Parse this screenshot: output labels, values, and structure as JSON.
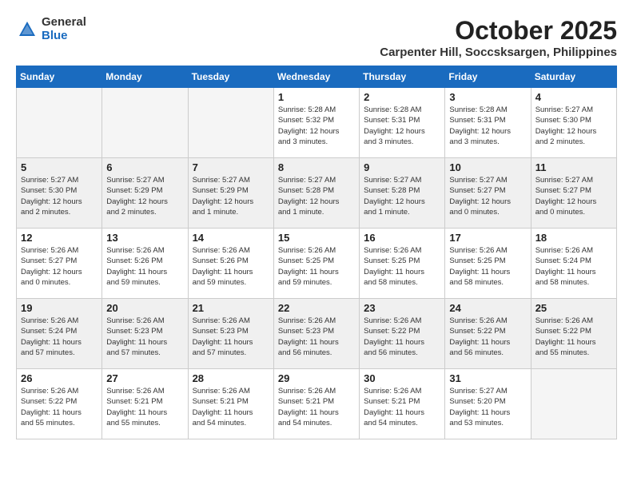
{
  "logo": {
    "general": "General",
    "blue": "Blue"
  },
  "header": {
    "month": "October 2025",
    "location": "Carpenter Hill, Soccsksargen, Philippines"
  },
  "weekdays": [
    "Sunday",
    "Monday",
    "Tuesday",
    "Wednesday",
    "Thursday",
    "Friday",
    "Saturday"
  ],
  "weeks": [
    [
      {
        "day": "",
        "info": ""
      },
      {
        "day": "",
        "info": ""
      },
      {
        "day": "",
        "info": ""
      },
      {
        "day": "1",
        "info": "Sunrise: 5:28 AM\nSunset: 5:32 PM\nDaylight: 12 hours\nand 3 minutes."
      },
      {
        "day": "2",
        "info": "Sunrise: 5:28 AM\nSunset: 5:31 PM\nDaylight: 12 hours\nand 3 minutes."
      },
      {
        "day": "3",
        "info": "Sunrise: 5:28 AM\nSunset: 5:31 PM\nDaylight: 12 hours\nand 3 minutes."
      },
      {
        "day": "4",
        "info": "Sunrise: 5:27 AM\nSunset: 5:30 PM\nDaylight: 12 hours\nand 2 minutes."
      }
    ],
    [
      {
        "day": "5",
        "info": "Sunrise: 5:27 AM\nSunset: 5:30 PM\nDaylight: 12 hours\nand 2 minutes."
      },
      {
        "day": "6",
        "info": "Sunrise: 5:27 AM\nSunset: 5:29 PM\nDaylight: 12 hours\nand 2 minutes."
      },
      {
        "day": "7",
        "info": "Sunrise: 5:27 AM\nSunset: 5:29 PM\nDaylight: 12 hours\nand 1 minute."
      },
      {
        "day": "8",
        "info": "Sunrise: 5:27 AM\nSunset: 5:28 PM\nDaylight: 12 hours\nand 1 minute."
      },
      {
        "day": "9",
        "info": "Sunrise: 5:27 AM\nSunset: 5:28 PM\nDaylight: 12 hours\nand 1 minute."
      },
      {
        "day": "10",
        "info": "Sunrise: 5:27 AM\nSunset: 5:27 PM\nDaylight: 12 hours\nand 0 minutes."
      },
      {
        "day": "11",
        "info": "Sunrise: 5:27 AM\nSunset: 5:27 PM\nDaylight: 12 hours\nand 0 minutes."
      }
    ],
    [
      {
        "day": "12",
        "info": "Sunrise: 5:26 AM\nSunset: 5:27 PM\nDaylight: 12 hours\nand 0 minutes."
      },
      {
        "day": "13",
        "info": "Sunrise: 5:26 AM\nSunset: 5:26 PM\nDaylight: 11 hours\nand 59 minutes."
      },
      {
        "day": "14",
        "info": "Sunrise: 5:26 AM\nSunset: 5:26 PM\nDaylight: 11 hours\nand 59 minutes."
      },
      {
        "day": "15",
        "info": "Sunrise: 5:26 AM\nSunset: 5:25 PM\nDaylight: 11 hours\nand 59 minutes."
      },
      {
        "day": "16",
        "info": "Sunrise: 5:26 AM\nSunset: 5:25 PM\nDaylight: 11 hours\nand 58 minutes."
      },
      {
        "day": "17",
        "info": "Sunrise: 5:26 AM\nSunset: 5:25 PM\nDaylight: 11 hours\nand 58 minutes."
      },
      {
        "day": "18",
        "info": "Sunrise: 5:26 AM\nSunset: 5:24 PM\nDaylight: 11 hours\nand 58 minutes."
      }
    ],
    [
      {
        "day": "19",
        "info": "Sunrise: 5:26 AM\nSunset: 5:24 PM\nDaylight: 11 hours\nand 57 minutes."
      },
      {
        "day": "20",
        "info": "Sunrise: 5:26 AM\nSunset: 5:23 PM\nDaylight: 11 hours\nand 57 minutes."
      },
      {
        "day": "21",
        "info": "Sunrise: 5:26 AM\nSunset: 5:23 PM\nDaylight: 11 hours\nand 57 minutes."
      },
      {
        "day": "22",
        "info": "Sunrise: 5:26 AM\nSunset: 5:23 PM\nDaylight: 11 hours\nand 56 minutes."
      },
      {
        "day": "23",
        "info": "Sunrise: 5:26 AM\nSunset: 5:22 PM\nDaylight: 11 hours\nand 56 minutes."
      },
      {
        "day": "24",
        "info": "Sunrise: 5:26 AM\nSunset: 5:22 PM\nDaylight: 11 hours\nand 56 minutes."
      },
      {
        "day": "25",
        "info": "Sunrise: 5:26 AM\nSunset: 5:22 PM\nDaylight: 11 hours\nand 55 minutes."
      }
    ],
    [
      {
        "day": "26",
        "info": "Sunrise: 5:26 AM\nSunset: 5:22 PM\nDaylight: 11 hours\nand 55 minutes."
      },
      {
        "day": "27",
        "info": "Sunrise: 5:26 AM\nSunset: 5:21 PM\nDaylight: 11 hours\nand 55 minutes."
      },
      {
        "day": "28",
        "info": "Sunrise: 5:26 AM\nSunset: 5:21 PM\nDaylight: 11 hours\nand 54 minutes."
      },
      {
        "day": "29",
        "info": "Sunrise: 5:26 AM\nSunset: 5:21 PM\nDaylight: 11 hours\nand 54 minutes."
      },
      {
        "day": "30",
        "info": "Sunrise: 5:26 AM\nSunset: 5:21 PM\nDaylight: 11 hours\nand 54 minutes."
      },
      {
        "day": "31",
        "info": "Sunrise: 5:27 AM\nSunset: 5:20 PM\nDaylight: 11 hours\nand 53 minutes."
      },
      {
        "day": "",
        "info": ""
      }
    ]
  ]
}
